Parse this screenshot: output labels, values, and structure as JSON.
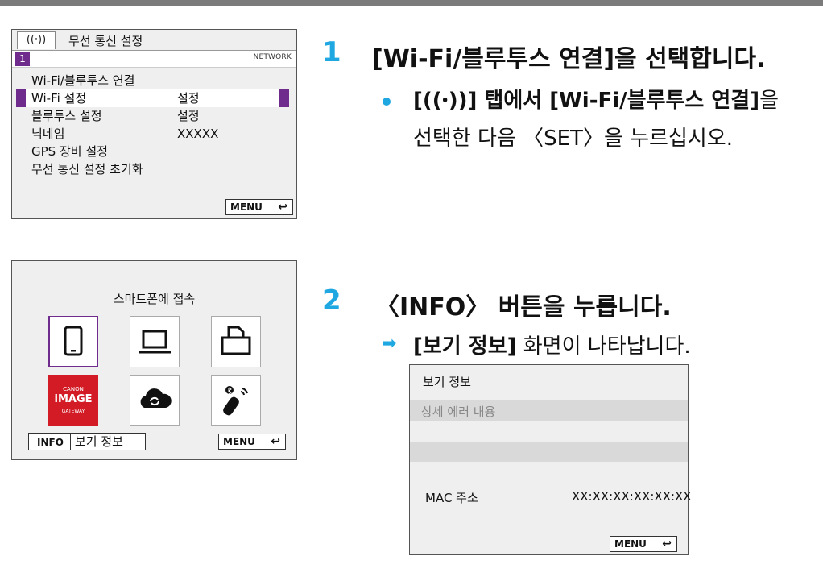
{
  "screen1": {
    "tab_icon": "((ꞏ))",
    "title": "무선 통신 설정",
    "page_number": "1",
    "page_label": "NETWORK",
    "items": [
      {
        "label": "Wi-Fi/블루투스 연결",
        "value": ""
      },
      {
        "label": "Wi-Fi 설정",
        "value": "설정"
      },
      {
        "label": "블루투스 설정",
        "value": "설정"
      },
      {
        "label": "닉네임",
        "value": "XXXXX"
      },
      {
        "label": "GPS 장비 설정",
        "value": ""
      },
      {
        "label": "무선 통신 설정 초기화",
        "value": ""
      }
    ],
    "menu_button": "MENU",
    "return_icon": "↩"
  },
  "step1": {
    "number": "1",
    "title": "[Wi-Fi/블루투스 연결]을 선택합니다.",
    "bullet_line1_pre": "[",
    "bullet_line1_icon": "((ꞏ))",
    "bullet_line1_mid": "] 탭에서 ",
    "bullet_line1_bold": "[Wi-Fi/블루투스 연결]",
    "bullet_line1_post": "을",
    "bullet_line2": "선택한 다음 〈SET〉을 누르십시오."
  },
  "screen2": {
    "title": "스마트폰에 접속",
    "canon_line1": "CANON",
    "canon_line2": "iMAGE",
    "canon_line3": "GATEWAY",
    "info_key": "INFO",
    "info_label": "보기 정보",
    "menu_button": "MENU",
    "return_icon": "↩"
  },
  "step2": {
    "number": "2",
    "title": "〈INFO〉 버튼을 누릅니다.",
    "arrow": "➡",
    "result_bold": "[보기 정보]",
    "result_rest": " 화면이 나타납니다."
  },
  "screen3": {
    "title": "보기 정보",
    "detail": "상세 에러 내용",
    "mac_label": "MAC 주소",
    "mac_value": "XX:XX:XX:XX:XX:XX",
    "menu_button": "MENU",
    "return_icon": "↩"
  },
  "colors": {
    "accent": "#1ea7e1",
    "selection": "#6f2c8c",
    "canon_red": "#d21b25"
  },
  "icons": [
    "smartphone-icon",
    "computer-icon",
    "printer-icon",
    "canon-image-gateway-icon",
    "cloud-sync-icon",
    "bluetooth-remote-icon"
  ]
}
